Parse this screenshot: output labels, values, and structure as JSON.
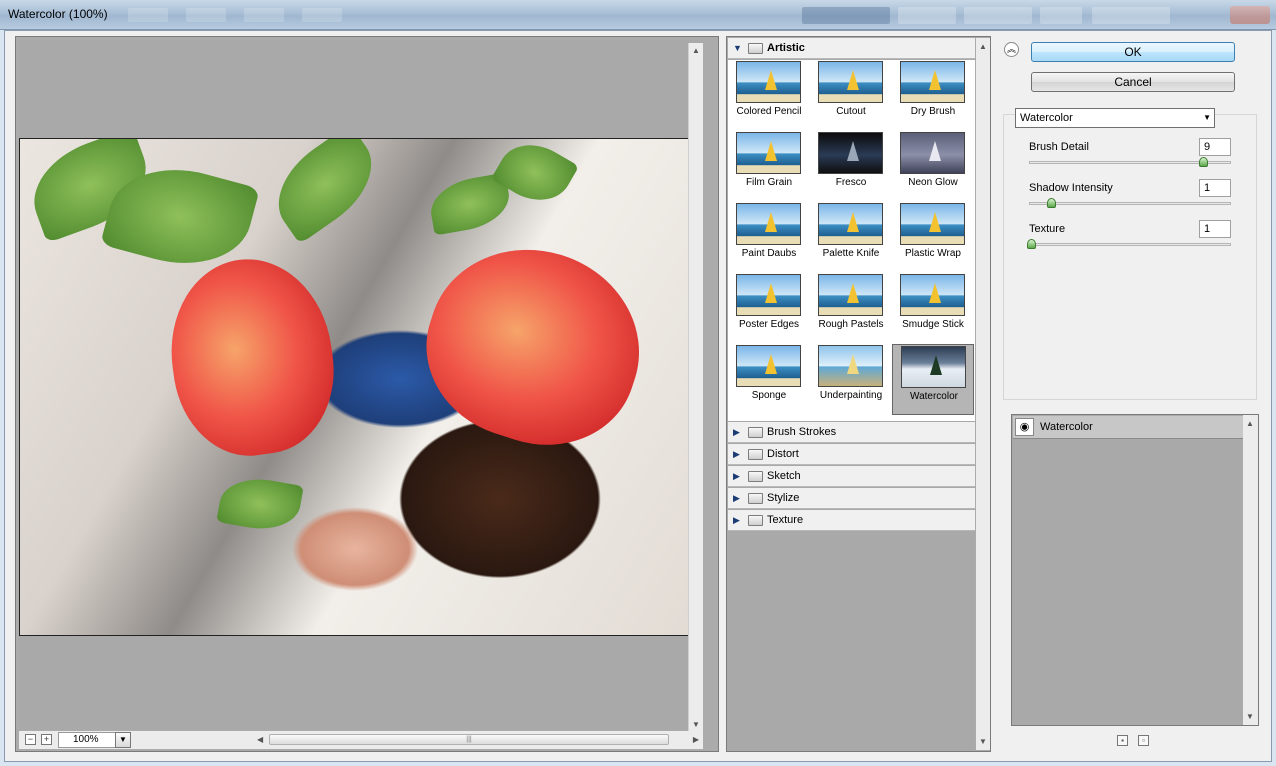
{
  "window": {
    "title": "Watercolor (100%)"
  },
  "preview": {
    "zoom": "100%",
    "zoom_in": "+",
    "zoom_out": "−"
  },
  "filters": {
    "artistic": {
      "label": "Artistic",
      "thumbnails": [
        "Colored Pencil",
        "Cutout",
        "Dry Brush",
        "Film Grain",
        "Fresco",
        "Neon Glow",
        "Paint Daubs",
        "Palette Knife",
        "Plastic Wrap",
        "Poster Edges",
        "Rough Pastels",
        "Smudge Stick",
        "Sponge",
        "Underpainting",
        "Watercolor"
      ],
      "selected": "Watercolor"
    },
    "categories": [
      "Brush Strokes",
      "Distort",
      "Sketch",
      "Stylize",
      "Texture"
    ]
  },
  "actions": {
    "ok": "OK",
    "cancel": "Cancel"
  },
  "settings": {
    "filter_select": "Watercolor",
    "params": [
      {
        "label": "Brush Detail",
        "value": "9",
        "level": 0.875
      },
      {
        "label": "Shadow Intensity",
        "value": "1",
        "level": 0.1
      },
      {
        "label": "Texture",
        "value": "1",
        "level": 0.0
      }
    ]
  },
  "layers": {
    "items": [
      "Watercolor"
    ]
  },
  "icons": {
    "collapse": "double-chevron-up-icon",
    "eye": "eye-icon",
    "new_layer": "new-effect-layer-icon",
    "delete_layer": "trash-icon",
    "folder": "folder-icon"
  }
}
